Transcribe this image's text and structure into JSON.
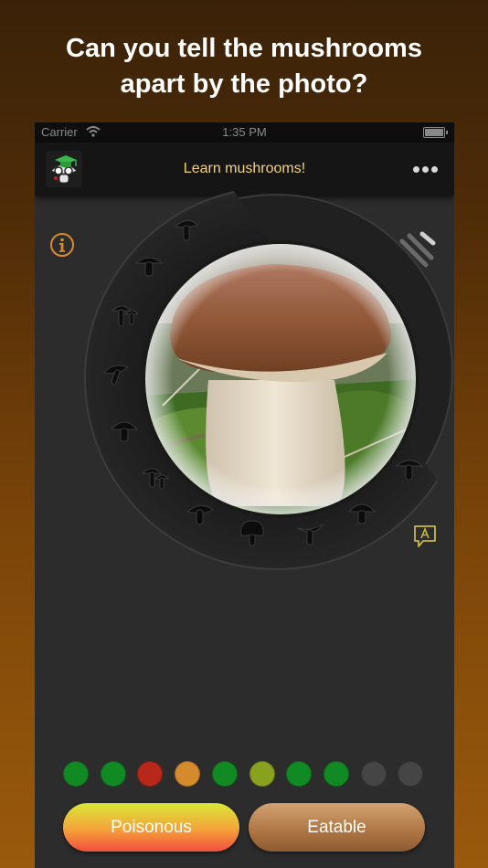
{
  "promo": {
    "headline_line1": "Can you tell the mushrooms",
    "headline_line2": "apart by the photo?"
  },
  "status_bar": {
    "carrier": "Carrier",
    "time": "1:35 PM"
  },
  "nav": {
    "title": "Learn mushrooms!"
  },
  "wheel": {
    "icons": [
      "mushroom-silhouette-icon",
      "mushroom-silhouette-icon",
      "mushroom-silhouette-icon",
      "mushroom-silhouette-icon",
      "mushroom-silhouette-icon",
      "mushroom-silhouette-icon",
      "mushroom-silhouette-icon",
      "mushroom-silhouette-icon",
      "mushroom-silhouette-icon",
      "mushroom-silhouette-icon",
      "mushroom-silhouette-icon",
      "mushroom-silhouette-icon"
    ]
  },
  "progress_dots": [
    {
      "state": "correct",
      "color": "#128a24"
    },
    {
      "state": "correct",
      "color": "#128a24"
    },
    {
      "state": "wrong",
      "color": "#b8281a"
    },
    {
      "state": "partial",
      "color": "#d58a2c"
    },
    {
      "state": "correct",
      "color": "#128a24"
    },
    {
      "state": "close",
      "color": "#86a21e"
    },
    {
      "state": "correct",
      "color": "#128a24"
    },
    {
      "state": "correct",
      "color": "#128a24"
    },
    {
      "state": "pending",
      "color": "#454545"
    },
    {
      "state": "pending",
      "color": "#454545"
    }
  ],
  "answers": {
    "poisonous_label": "Poisonous",
    "eatable_label": "Eatable"
  },
  "colors": {
    "accent": "#f3d27a",
    "icon_orange": "#d98a2c",
    "icon_green": "#c7b745"
  }
}
